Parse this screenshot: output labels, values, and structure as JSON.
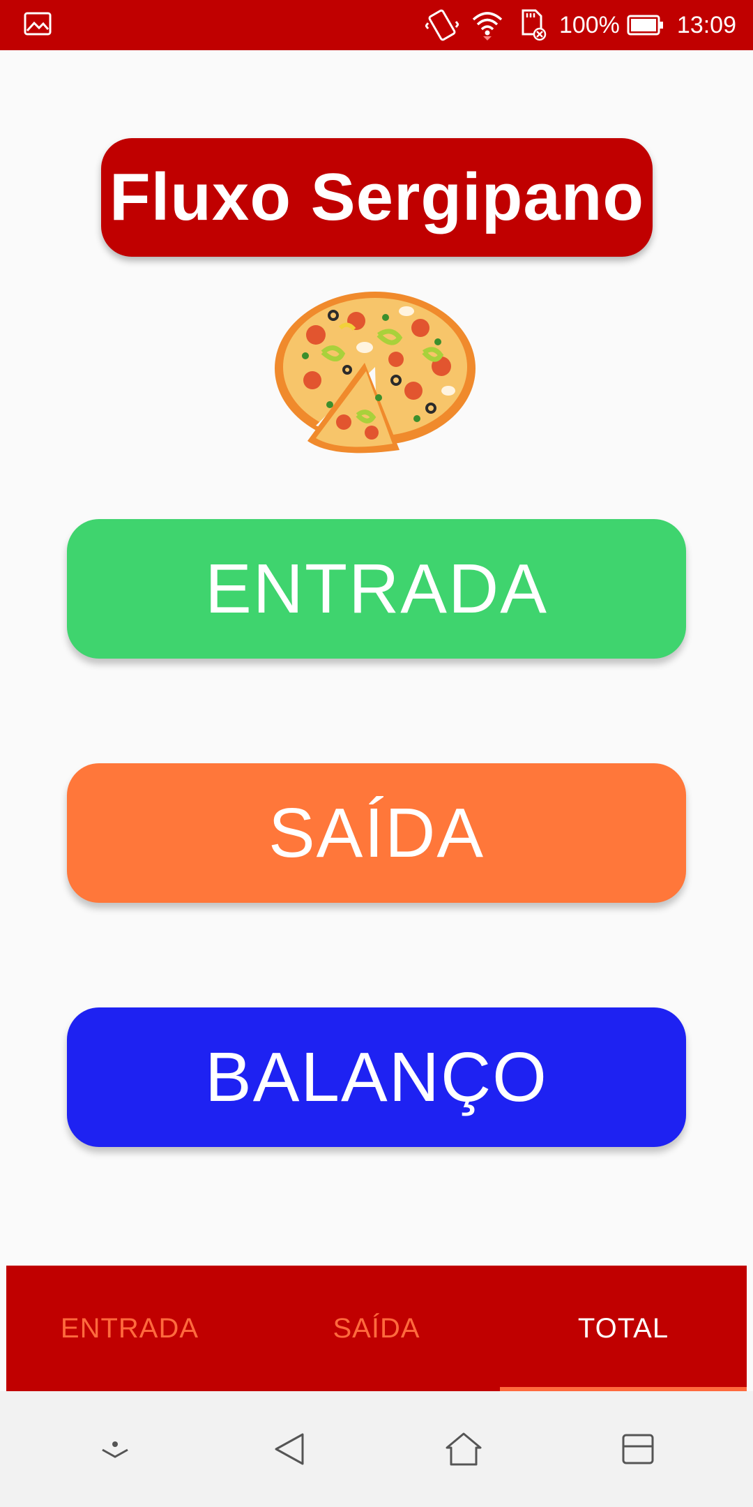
{
  "status_bar": {
    "battery_percent": "100%",
    "time": "13:09",
    "icons": [
      "image-notification-icon",
      "vibrate-icon",
      "wifi-icon",
      "sd-card-icon",
      "battery-icon"
    ]
  },
  "header": {
    "title": "Fluxo Sergipano"
  },
  "main": {
    "buttons": {
      "entrada": "ENTRADA",
      "saida": "SAÍDA",
      "balanco": "BALANÇO"
    }
  },
  "tabs": [
    {
      "label": "ENTRADA",
      "active": false
    },
    {
      "label": "SAÍDA",
      "active": false
    },
    {
      "label": "TOTAL",
      "active": true
    }
  ],
  "colors": {
    "primary": "#c00000",
    "entrada": "#3fd46e",
    "saida": "#ff773a",
    "balanco": "#1e22f2",
    "tab_inactive": "#ff6a3d"
  },
  "nav_bar": {
    "icons": [
      "notification-collapse-icon",
      "back-icon",
      "home-icon",
      "recents-icon"
    ]
  }
}
